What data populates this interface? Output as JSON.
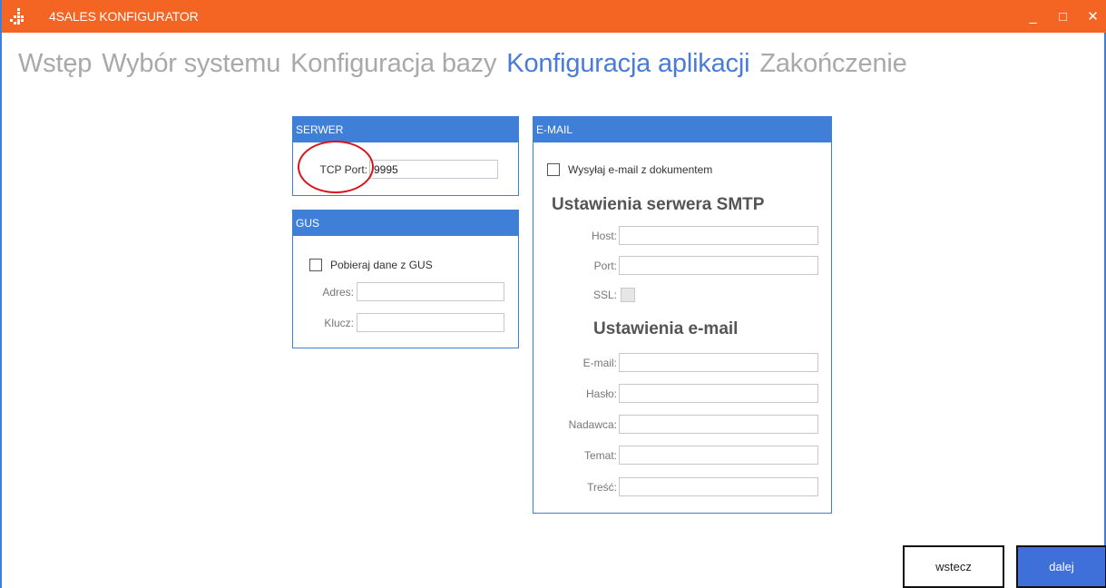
{
  "titlebar": {
    "title": "4SALES KONFIGURATOR",
    "minimize": "_",
    "maximize": "□",
    "close": "✕"
  },
  "steps": [
    {
      "label": "Wstęp",
      "active": false
    },
    {
      "label": "Wybór systemu",
      "active": false
    },
    {
      "label": "Konfiguracja bazy",
      "active": false
    },
    {
      "label": "Konfiguracja aplikacji",
      "active": true
    },
    {
      "label": "Zakończenie",
      "active": false
    }
  ],
  "serwer": {
    "header": "SERWER",
    "tcp_port_label": "TCP Port:",
    "tcp_port_value": "9995"
  },
  "gus": {
    "header": "GUS",
    "checkbox_label": "Pobieraj dane z GUS",
    "checked": false,
    "adres_label": "Adres:",
    "adres_value": "",
    "klucz_label": "Klucz:",
    "klucz_value": ""
  },
  "email": {
    "header": "E-MAIL",
    "send_checkbox_label": "Wysyłaj e-mail z dokumentem",
    "send_checked": false,
    "smtp_title": "Ustawienia serwera SMTP",
    "host_label": "Host:",
    "host_value": "",
    "port_label": "Port:",
    "port_value": "",
    "ssl_label": "SSL:",
    "ssl_checked": false,
    "email_settings_title": "Ustawienia e-mail",
    "email_label": "E-mail:",
    "email_value": "",
    "haslo_label": "Hasło:",
    "haslo_value": "",
    "nadawca_label": "Nadawca:",
    "nadawca_value": "",
    "temat_label": "Temat:",
    "temat_value": "",
    "tresc_label": "Treść:",
    "tresc_value": ""
  },
  "buttons": {
    "back": "wstecz",
    "next": "dalej"
  },
  "colors": {
    "titlebar": "#f46524",
    "accent": "#3f7fd8",
    "active_step": "#4a7bd8",
    "inactive_step": "#a9a9a9",
    "annotation": "#d9141a"
  }
}
